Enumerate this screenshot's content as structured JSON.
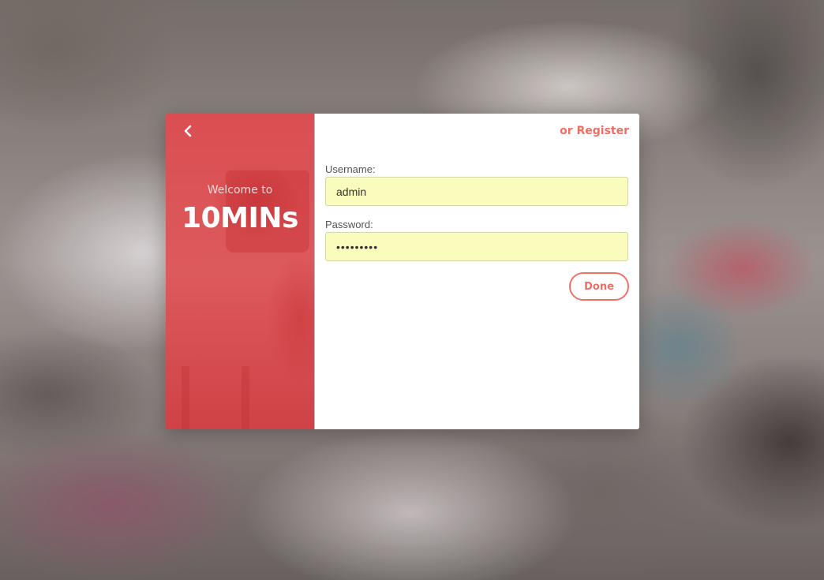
{
  "theme": {
    "accent": "#f06d64",
    "panel_red": "#d9474a",
    "input_bg": "#fafcbd"
  },
  "left_panel": {
    "back_icon": "chevron-left-icon",
    "welcome_text": "Welcome to",
    "brand_name": "10MINs"
  },
  "header": {
    "register_link": "or Register"
  },
  "form": {
    "username": {
      "label": "Username:",
      "value": "admin"
    },
    "password": {
      "label": "Password:",
      "value": "123456789"
    },
    "submit_label": "Done"
  }
}
